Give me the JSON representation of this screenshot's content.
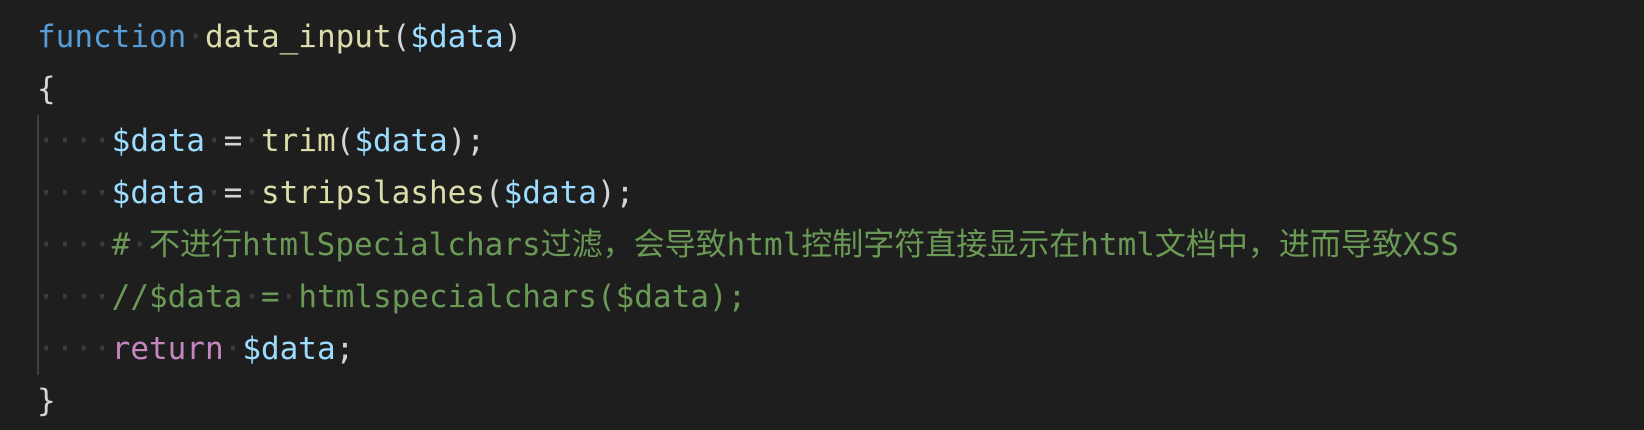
{
  "code": {
    "line1": {
      "keyword": "function",
      "name": "data_input",
      "open_paren": "(",
      "param": "$data",
      "close_paren": ")"
    },
    "line2": {
      "brace": "{"
    },
    "line3": {
      "var": "$data",
      "op": "=",
      "fn": "trim",
      "open": "(",
      "arg": "$data",
      "close": ");"
    },
    "line4": {
      "var": "$data",
      "op": "=",
      "fn": "stripslashes",
      "open": "(",
      "arg": "$data",
      "close": ");"
    },
    "line5": {
      "hash": "#",
      "comment": "不进行htmlSpecialchars过滤，会导致html控制字符直接显示在html文档中，进而导致XSS"
    },
    "line6": {
      "comment_a": "//$data",
      "comment_b": "=",
      "comment_c": "htmlspecialchars($data);"
    },
    "line7": {
      "keyword": "return",
      "var": "$data",
      "semi": ";"
    },
    "line8": {
      "brace": "}"
    }
  },
  "theme": {
    "background": "#1e1e1e",
    "keyword_color": "#569cd6",
    "function_color": "#dcdcaa",
    "variable_color": "#9cdcfe",
    "return_color": "#c586c0",
    "comment_color": "#6a9955",
    "text_color": "#d4d4d4"
  }
}
